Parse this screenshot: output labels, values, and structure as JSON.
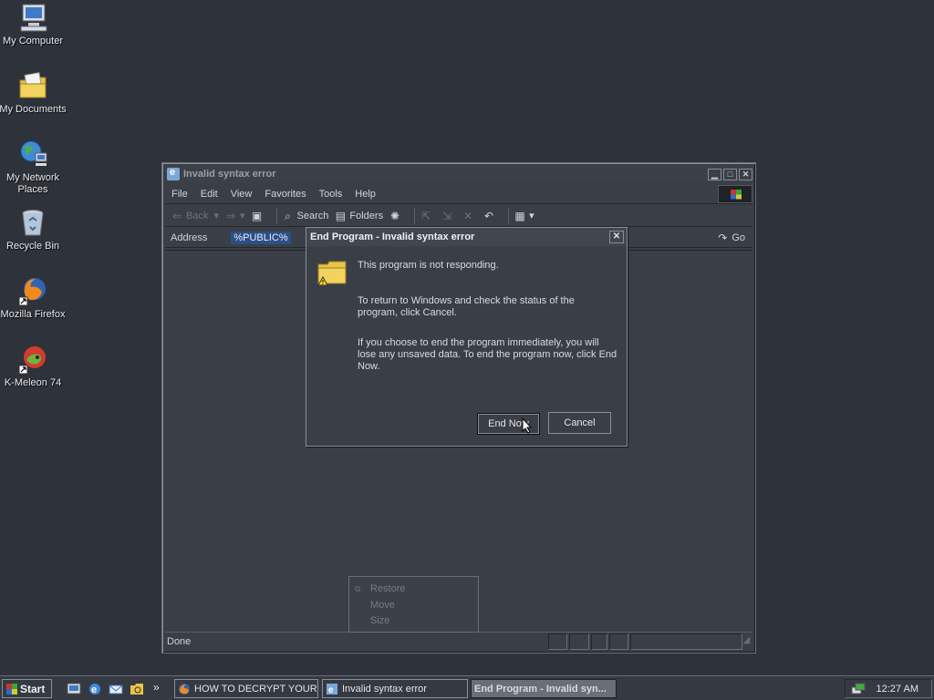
{
  "desktop": {
    "icons": [
      {
        "label": "My Computer"
      },
      {
        "label": "My Documents"
      },
      {
        "label": "My Network Places"
      },
      {
        "label": "Recycle Bin"
      },
      {
        "label": "Mozilla Firefox"
      },
      {
        "label": "K-Meleon 74"
      }
    ]
  },
  "window": {
    "title": "Invalid syntax error",
    "menu": [
      "File",
      "Edit",
      "View",
      "Favorites",
      "Tools",
      "Help"
    ],
    "toolbar": {
      "back": "Back",
      "search": "Search",
      "folders": "Folders"
    },
    "address": {
      "label": "Address",
      "value": "%PUBLIC%",
      "go": "Go"
    },
    "status": "Done"
  },
  "dialog": {
    "title": "End Program - Invalid syntax error",
    "line1": "This program is not responding.",
    "line2": "To return to Windows and check the status of the program, click Cancel.",
    "line3": "If you choose to end the program immediately, you will lose any unsaved data. To end the program now, click End Now.",
    "end_now": "End Now",
    "cancel": "Cancel"
  },
  "context_menu": {
    "items": [
      "Restore",
      "Move",
      "Size"
    ]
  },
  "taskbar": {
    "start": "Start",
    "chevron": "»",
    "tasks": [
      {
        "label": "HOW TO DECRYPT YOUR ..."
      },
      {
        "label": "Invalid syntax error"
      },
      {
        "label": "End Program - Invalid syn..."
      }
    ],
    "clock": "12:27 AM"
  },
  "colors": {
    "desktop_bg": "#2e333b",
    "window_bg": "#3a3f47",
    "address_highlight": "#2b4f86",
    "active_task": "#6a6f77"
  }
}
